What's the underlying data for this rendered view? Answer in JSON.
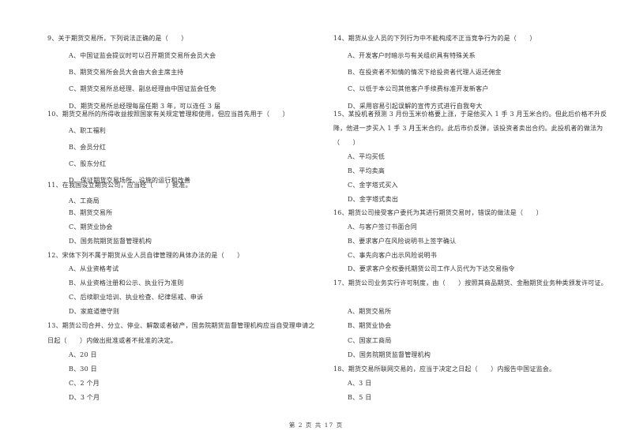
{
  "left_column": {
    "questions": [
      {
        "number": "9",
        "stem_lines": [
          "9、关于期货交易所，下列说法正确的是（　　）"
        ],
        "options": [
          "A、中国证监会提议时可以召开期货交易所会员大会",
          "B、期货交易所会员大会由大会主席主持",
          "C、期货交易所总经理、副总经理由中国证监会任免",
          "D、期货交易所总经理每届任期 3 年，可以连任 3 届"
        ]
      },
      {
        "number": "10",
        "stem_lines": [
          "10、期货交易所的所得收益按照国家有关规定管理和使用，但应当首先用于（　　）"
        ],
        "options": [
          "A、职工福利",
          "B、会员分红",
          "C、股东分红",
          "D、保证期货交易场所、设施的运行和改善"
        ]
      },
      {
        "number": "11",
        "stem_lines": [
          "11、在我国设立期货公司，应当经（　　）批准。"
        ],
        "options": [
          "A、工商局",
          "B、期货交易所",
          "C、期货业协会",
          "D、国务院期货监督管理机构"
        ]
      },
      {
        "number": "12",
        "stem_lines": [
          "12、宋体下列不属于期货从业人员自律管理的具体办法的是（　　）"
        ],
        "options": [
          "A、从业资格考试",
          "B、从业资格注册和公示、执业行为准则",
          "C、后续职业培训、执业检查、纪律惩戒、申诉",
          "D、家庭道德守则"
        ]
      },
      {
        "number": "13",
        "stem_lines": [
          "13、期货公司合并、分立、停业、解散或者破产，国务院期货监督管理机构应当自受理申请之",
          "日起（　　）内做出批准或者不批准的决定。"
        ],
        "options": [
          "A、20 日",
          "B、30 日",
          "C、2 个月",
          "D、3 个月"
        ]
      }
    ]
  },
  "right_column": {
    "questions": [
      {
        "number": "14",
        "stem_lines": [
          "14、期货从业人员的下列行为中不能构成不正当竞争行为的是（　　）"
        ],
        "options": [
          "A、开发客户时暗示与有关组织具有特殊关系",
          "B、在投资者不知情的情况下给投资者代理人返还佣金",
          "C、以低于本公司其他客户手续费标准开发新客户",
          "D、采用容易引起误解的宣传方式进行自我夸大"
        ]
      },
      {
        "number": "15",
        "stem_lines": [
          "15、某投机者预测 3 月份玉米价格要上涨，于是他买入 1 手 3 月玉米合约。但此后价格不升反",
          "降，他进一步买入 1 手 3 月玉米合约。此后市价反弹，该投资者卖出合约。此投机者的做法为",
          "（　　）"
        ],
        "options": [
          "A、平均买低",
          "B、平均卖高",
          "C、金字塔式买入",
          "D、金字塔式卖出"
        ]
      },
      {
        "number": "16",
        "stem_lines": [
          "16、期货公司接受客户委托为其进行期货交易时，错误的做法是（　　）"
        ],
        "options": [
          "A、与客户签订书面合同",
          "B、要求客户在风险说明书上签字确认",
          "C、事先向客户出示风险说明书",
          "D、要求客户全权委托期货公司工作人员代为下达交易指令"
        ]
      },
      {
        "number": "17",
        "stem_lines": [
          "17、期货公司业务实行许可制度，由（　　）按照其商品期货、金融期货业务种类颁发许可证。"
        ],
        "options": [
          "A、期货交易所",
          "B、期货业协会",
          "C、国家工商局",
          "D、国务院期货监督管理机构"
        ]
      },
      {
        "number": "18",
        "stem_lines": [
          "18、期货交易所联网交易的，应当于决定之日起（　　）内报告中国证监会。"
        ],
        "options": [
          "A、3 日",
          "B、5 日"
        ]
      }
    ]
  },
  "footer": {
    "page_label": "第 2 页 共 17 页"
  }
}
